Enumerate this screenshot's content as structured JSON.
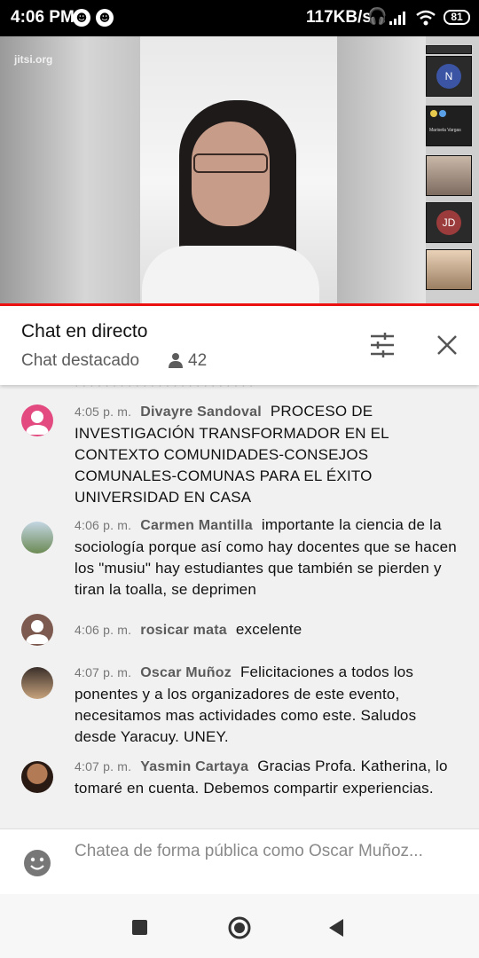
{
  "status_bar": {
    "time": "4:06 PM",
    "speed": "117KB/s",
    "battery": "81"
  },
  "video": {
    "watermark": "jitsi.org",
    "tiles": [
      {
        "initial": "N",
        "name": ""
      },
      {
        "initial": "",
        "name": "Marisela Vargas"
      },
      {
        "initial": "JD",
        "name": ""
      }
    ]
  },
  "chat_header": {
    "title": "Chat en directo",
    "subtitle": "Chat destacado",
    "viewer_count": "42"
  },
  "messages": [
    {
      "time": "4:05 p. m.",
      "author": "Divayre Sandoval",
      "text": "PROCESO DE INVESTIGACIÓN TRANSFORMADOR EN EL CONTEXTO COMUNIDADES-CONSEJOS COMUNALES-COMUNAS PARA EL ÉXITO UNIVERSIDAD EN CASA"
    },
    {
      "time": "4:06 p. m.",
      "author": "Carmen Mantilla",
      "text": "importante la ciencia de la sociología porque así como hay docentes que se hacen los \"musiu\" hay estudiantes que también se pierden y tiran la toalla, se deprimen"
    },
    {
      "time": "4:06 p. m.",
      "author": "rosicar mata",
      "text": "excelente"
    },
    {
      "time": "4:07 p. m.",
      "author": "Oscar Muñoz",
      "text": "Felicitaciones a todos los ponentes y a los organizadores de este evento, necesitamos mas actividades como este. Saludos desde Yaracuy. UNEY."
    },
    {
      "time": "4:07 p. m.",
      "author": "Yasmin Cartaya",
      "text": "Gracias Profa. Katherina, lo tomaré en cuenta. Debemos compartir experiencias."
    }
  ],
  "chat_input": {
    "placeholder": "Chatea de forma pública como Oscar Muñoz..."
  },
  "colors": {
    "accent": "#e52222",
    "header_bg": "#ffffff",
    "chat_bg": "#f1f1f1"
  },
  "icons": [
    "filter-icon",
    "close-icon",
    "person-icon",
    "emoji-icon",
    "recents-icon",
    "home-icon",
    "back-icon",
    "wifi-icon",
    "signal-icon",
    "headphones-icon"
  ]
}
